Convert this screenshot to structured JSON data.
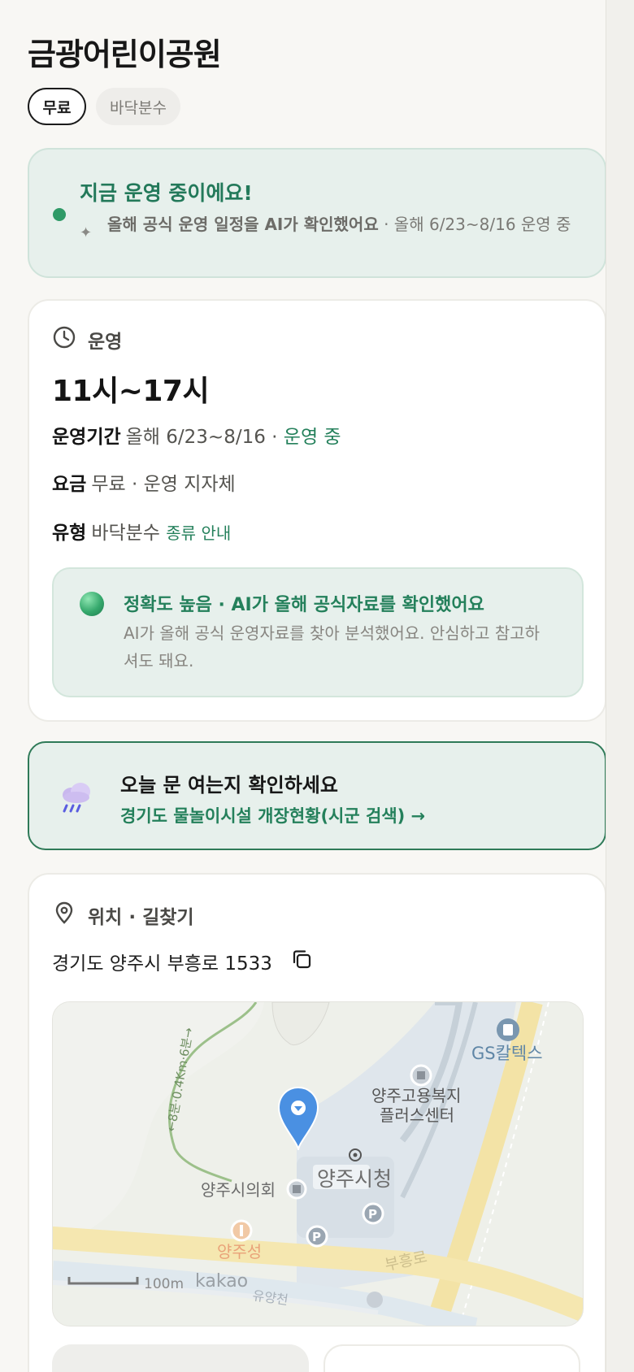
{
  "park": {
    "name": "금광어린이공원",
    "tags": [
      "무료",
      "바닥분수"
    ]
  },
  "status": {
    "title": "지금 운영 중이에요!",
    "sub_bold": "올해 공식 운영 일정을 AI가 확인했어요",
    "sub_rest": " · 올해 6/23~8/16 운영 중"
  },
  "operation": {
    "header": "운영",
    "hours": "11시~17시",
    "period_label": "운영기간",
    "period_value": "올해 6/23~8/16 · ",
    "period_status": "운영 중",
    "fee_label": "요금",
    "fee_value": "무료 · 운영 지자체",
    "type_label": "유형",
    "type_value": "바닥분수",
    "type_link": "종류 안내",
    "accuracy_title": "정확도 높음 · AI가 올해 공식자료를 확인했어요",
    "accuracy_body": "AI가 올해 공식 운영자료를 찾아 분석했어요. 안심하고 참고하셔도 돼요."
  },
  "notice": {
    "title": "오늘 문 여는지 확인하세요",
    "link": "경기도 물놀이시설 개장현황(시군 검색) →"
  },
  "location": {
    "header": "위치 · 길찾기",
    "address": "경기도 양주시 부흥로 1533",
    "map_labels": {
      "gs": "GS칼텍스",
      "welfare_line1": "양주고용복지",
      "welfare_line2": "플러스센터",
      "city_hall": "양주시청",
      "council": "양주시의회",
      "restaurant": "양주성",
      "road": "부흥로",
      "trail": "←8분·0.4Km·6분→",
      "scale": "100m",
      "brand": "kakao",
      "stream": "유양천"
    }
  },
  "colors": {
    "accent_green": "#24805b",
    "status_bg": "#e7f0ec",
    "pin_blue": "#4a90e2"
  }
}
